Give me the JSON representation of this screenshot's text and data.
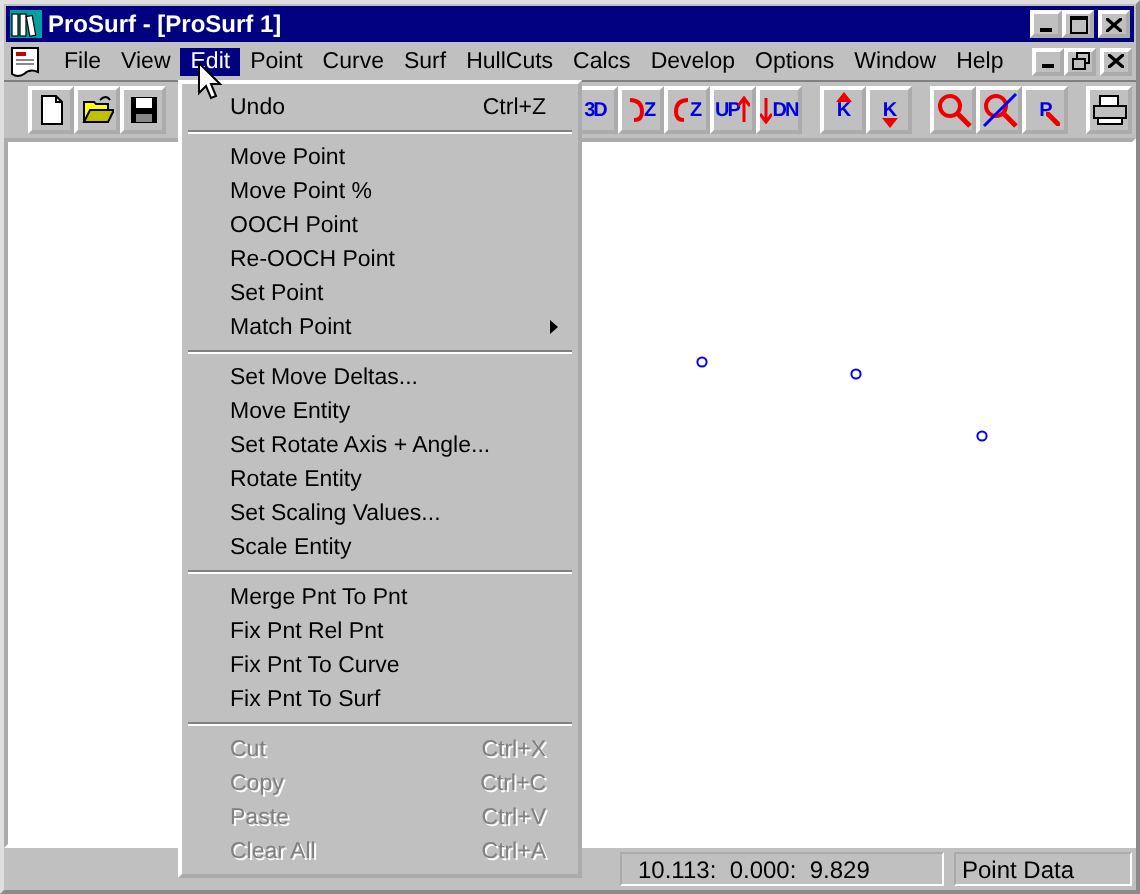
{
  "window": {
    "title": "ProSurf - [ProSurf 1]"
  },
  "menu_bar": [
    {
      "label": "File",
      "selected": false
    },
    {
      "label": "View",
      "selected": false
    },
    {
      "label": "Edit",
      "selected": true
    },
    {
      "label": "Point",
      "selected": false
    },
    {
      "label": "Curve",
      "selected": false
    },
    {
      "label": "Surf",
      "selected": false
    },
    {
      "label": "HullCuts",
      "selected": false
    },
    {
      "label": "Calcs",
      "selected": false
    },
    {
      "label": "Develop",
      "selected": false
    },
    {
      "label": "Options",
      "selected": false
    },
    {
      "label": "Window",
      "selected": false
    },
    {
      "label": "Help",
      "selected": false
    }
  ],
  "toolbar_left": [
    {
      "kind": "new"
    },
    {
      "kind": "open"
    },
    {
      "kind": "save"
    }
  ],
  "toolbar_right": [
    [
      {
        "kind": "view3d",
        "label": "3D"
      },
      {
        "kind": "rotate-cw",
        "label": "Z"
      },
      {
        "kind": "rotate-ccw",
        "label": "Z"
      },
      {
        "kind": "up",
        "label": "UP"
      },
      {
        "kind": "down",
        "label": "DN"
      }
    ],
    [
      {
        "kind": "k-up",
        "label": "K"
      },
      {
        "kind": "k-down",
        "label": "K"
      }
    ],
    [
      {
        "kind": "zoom"
      },
      {
        "kind": "zoom-cancel"
      },
      {
        "kind": "zoom-pan",
        "label": "P"
      }
    ],
    [
      {
        "kind": "print"
      }
    ]
  ],
  "edit_menu": [
    [
      {
        "label": "Undo",
        "shortcut": "Ctrl+Z",
        "disabled": false,
        "submenu": false
      }
    ],
    [
      {
        "label": "Move Point",
        "disabled": false,
        "submenu": false
      },
      {
        "label": "Move Point %",
        "disabled": false,
        "submenu": false
      },
      {
        "label": "OOCH Point",
        "disabled": false,
        "submenu": false
      },
      {
        "label": "Re-OOCH Point",
        "disabled": false,
        "submenu": false
      },
      {
        "label": "Set Point",
        "disabled": false,
        "submenu": false
      },
      {
        "label": "Match Point",
        "disabled": false,
        "submenu": true
      }
    ],
    [
      {
        "label": "Set Move Deltas...",
        "disabled": false,
        "submenu": false
      },
      {
        "label": "Move Entity",
        "disabled": false,
        "submenu": false
      },
      {
        "label": "Set Rotate Axis + Angle...",
        "disabled": false,
        "submenu": false
      },
      {
        "label": "Rotate Entity",
        "disabled": false,
        "submenu": false
      },
      {
        "label": "Set Scaling Values...",
        "disabled": false,
        "submenu": false
      },
      {
        "label": "Scale Entity",
        "disabled": false,
        "submenu": false
      }
    ],
    [
      {
        "label": "Merge Pnt To Pnt",
        "disabled": false,
        "submenu": false
      },
      {
        "label": "Fix Pnt Rel Pnt",
        "disabled": false,
        "submenu": false
      },
      {
        "label": "Fix Pnt To Curve",
        "disabled": false,
        "submenu": false
      },
      {
        "label": "Fix Pnt To Surf",
        "disabled": false,
        "submenu": false
      }
    ],
    [
      {
        "label": "Cut",
        "shortcut": "Ctrl+X",
        "disabled": true,
        "submenu": false
      },
      {
        "label": "Copy",
        "shortcut": "Ctrl+C",
        "disabled": true,
        "submenu": false
      },
      {
        "label": "Paste",
        "shortcut": "Ctrl+V",
        "disabled": true,
        "submenu": false
      },
      {
        "label": "Clear All",
        "shortcut": "Ctrl+A",
        "disabled": true,
        "submenu": false
      }
    ]
  ],
  "status_bar": {
    "coordinates": "10.113:  0.000:  9.829",
    "mode": "Point Data"
  }
}
